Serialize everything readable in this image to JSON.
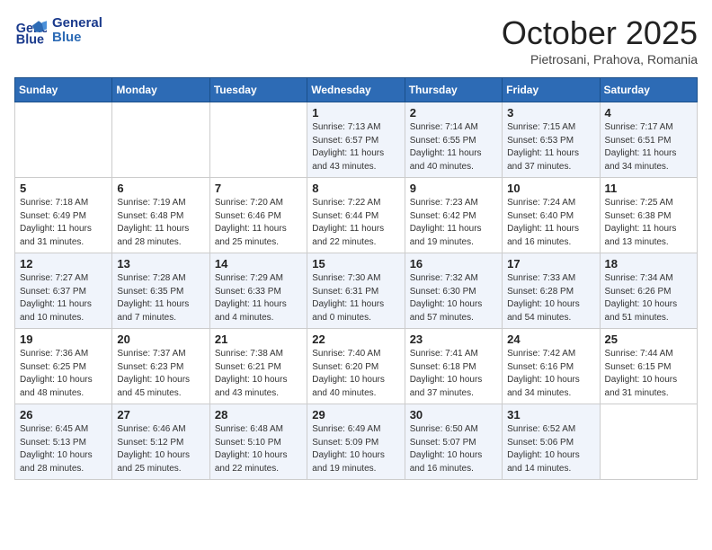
{
  "header": {
    "logo_line1": "General",
    "logo_line2": "Blue",
    "month_title": "October 2025",
    "location": "Pietrosani, Prahova, Romania"
  },
  "weekdays": [
    "Sunday",
    "Monday",
    "Tuesday",
    "Wednesday",
    "Thursday",
    "Friday",
    "Saturday"
  ],
  "weeks": [
    [
      {
        "day": "",
        "info": ""
      },
      {
        "day": "",
        "info": ""
      },
      {
        "day": "",
        "info": ""
      },
      {
        "day": "1",
        "info": "Sunrise: 7:13 AM\nSunset: 6:57 PM\nDaylight: 11 hours\nand 43 minutes."
      },
      {
        "day": "2",
        "info": "Sunrise: 7:14 AM\nSunset: 6:55 PM\nDaylight: 11 hours\nand 40 minutes."
      },
      {
        "day": "3",
        "info": "Sunrise: 7:15 AM\nSunset: 6:53 PM\nDaylight: 11 hours\nand 37 minutes."
      },
      {
        "day": "4",
        "info": "Sunrise: 7:17 AM\nSunset: 6:51 PM\nDaylight: 11 hours\nand 34 minutes."
      }
    ],
    [
      {
        "day": "5",
        "info": "Sunrise: 7:18 AM\nSunset: 6:49 PM\nDaylight: 11 hours\nand 31 minutes."
      },
      {
        "day": "6",
        "info": "Sunrise: 7:19 AM\nSunset: 6:48 PM\nDaylight: 11 hours\nand 28 minutes."
      },
      {
        "day": "7",
        "info": "Sunrise: 7:20 AM\nSunset: 6:46 PM\nDaylight: 11 hours\nand 25 minutes."
      },
      {
        "day": "8",
        "info": "Sunrise: 7:22 AM\nSunset: 6:44 PM\nDaylight: 11 hours\nand 22 minutes."
      },
      {
        "day": "9",
        "info": "Sunrise: 7:23 AM\nSunset: 6:42 PM\nDaylight: 11 hours\nand 19 minutes."
      },
      {
        "day": "10",
        "info": "Sunrise: 7:24 AM\nSunset: 6:40 PM\nDaylight: 11 hours\nand 16 minutes."
      },
      {
        "day": "11",
        "info": "Sunrise: 7:25 AM\nSunset: 6:38 PM\nDaylight: 11 hours\nand 13 minutes."
      }
    ],
    [
      {
        "day": "12",
        "info": "Sunrise: 7:27 AM\nSunset: 6:37 PM\nDaylight: 11 hours\nand 10 minutes."
      },
      {
        "day": "13",
        "info": "Sunrise: 7:28 AM\nSunset: 6:35 PM\nDaylight: 11 hours\nand 7 minutes."
      },
      {
        "day": "14",
        "info": "Sunrise: 7:29 AM\nSunset: 6:33 PM\nDaylight: 11 hours\nand 4 minutes."
      },
      {
        "day": "15",
        "info": "Sunrise: 7:30 AM\nSunset: 6:31 PM\nDaylight: 11 hours\nand 0 minutes."
      },
      {
        "day": "16",
        "info": "Sunrise: 7:32 AM\nSunset: 6:30 PM\nDaylight: 10 hours\nand 57 minutes."
      },
      {
        "day": "17",
        "info": "Sunrise: 7:33 AM\nSunset: 6:28 PM\nDaylight: 10 hours\nand 54 minutes."
      },
      {
        "day": "18",
        "info": "Sunrise: 7:34 AM\nSunset: 6:26 PM\nDaylight: 10 hours\nand 51 minutes."
      }
    ],
    [
      {
        "day": "19",
        "info": "Sunrise: 7:36 AM\nSunset: 6:25 PM\nDaylight: 10 hours\nand 48 minutes."
      },
      {
        "day": "20",
        "info": "Sunrise: 7:37 AM\nSunset: 6:23 PM\nDaylight: 10 hours\nand 45 minutes."
      },
      {
        "day": "21",
        "info": "Sunrise: 7:38 AM\nSunset: 6:21 PM\nDaylight: 10 hours\nand 43 minutes."
      },
      {
        "day": "22",
        "info": "Sunrise: 7:40 AM\nSunset: 6:20 PM\nDaylight: 10 hours\nand 40 minutes."
      },
      {
        "day": "23",
        "info": "Sunrise: 7:41 AM\nSunset: 6:18 PM\nDaylight: 10 hours\nand 37 minutes."
      },
      {
        "day": "24",
        "info": "Sunrise: 7:42 AM\nSunset: 6:16 PM\nDaylight: 10 hours\nand 34 minutes."
      },
      {
        "day": "25",
        "info": "Sunrise: 7:44 AM\nSunset: 6:15 PM\nDaylight: 10 hours\nand 31 minutes."
      }
    ],
    [
      {
        "day": "26",
        "info": "Sunrise: 6:45 AM\nSunset: 5:13 PM\nDaylight: 10 hours\nand 28 minutes."
      },
      {
        "day": "27",
        "info": "Sunrise: 6:46 AM\nSunset: 5:12 PM\nDaylight: 10 hours\nand 25 minutes."
      },
      {
        "day": "28",
        "info": "Sunrise: 6:48 AM\nSunset: 5:10 PM\nDaylight: 10 hours\nand 22 minutes."
      },
      {
        "day": "29",
        "info": "Sunrise: 6:49 AM\nSunset: 5:09 PM\nDaylight: 10 hours\nand 19 minutes."
      },
      {
        "day": "30",
        "info": "Sunrise: 6:50 AM\nSunset: 5:07 PM\nDaylight: 10 hours\nand 16 minutes."
      },
      {
        "day": "31",
        "info": "Sunrise: 6:52 AM\nSunset: 5:06 PM\nDaylight: 10 hours\nand 14 minutes."
      },
      {
        "day": "",
        "info": ""
      }
    ]
  ]
}
